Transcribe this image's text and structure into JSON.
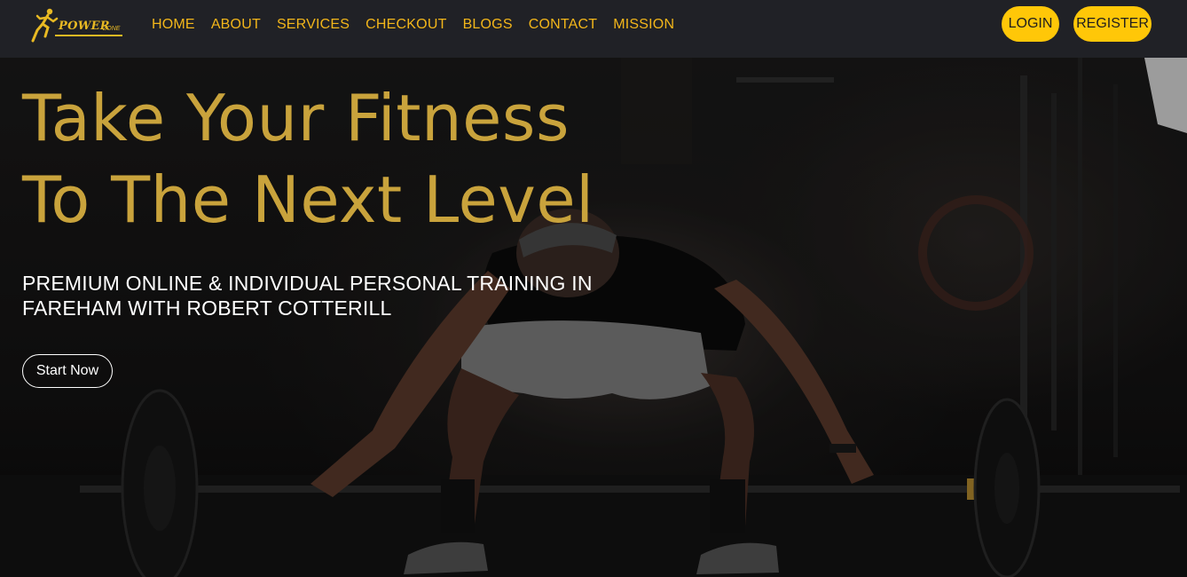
{
  "brand": {
    "name_primary": "POWER",
    "name_secondary": "ZONE",
    "logo_icon": "runner-icon",
    "accent_color": "#f3b61a"
  },
  "nav": {
    "links": [
      {
        "label": "HOME"
      },
      {
        "label": "ABOUT"
      },
      {
        "label": "SERVICES"
      },
      {
        "label": "CHECKOUT"
      },
      {
        "label": "BLOGS"
      },
      {
        "label": "CONTACT"
      },
      {
        "label": "MISSION"
      }
    ],
    "login_label": "LOGIN",
    "register_label": "REGISTER",
    "button_color": "#ffc708"
  },
  "hero": {
    "title_line1": "Take Your Fitness",
    "title_line2": "To The Next Level",
    "subtitle_line1": "PREMIUM ONLINE & INDIVIDUAL PERSONAL TRAINING IN",
    "subtitle_line2": "FAREHAM WITH ROBERT COTTERILL",
    "cta_label": "Start Now",
    "title_color": "#c9a33c"
  }
}
